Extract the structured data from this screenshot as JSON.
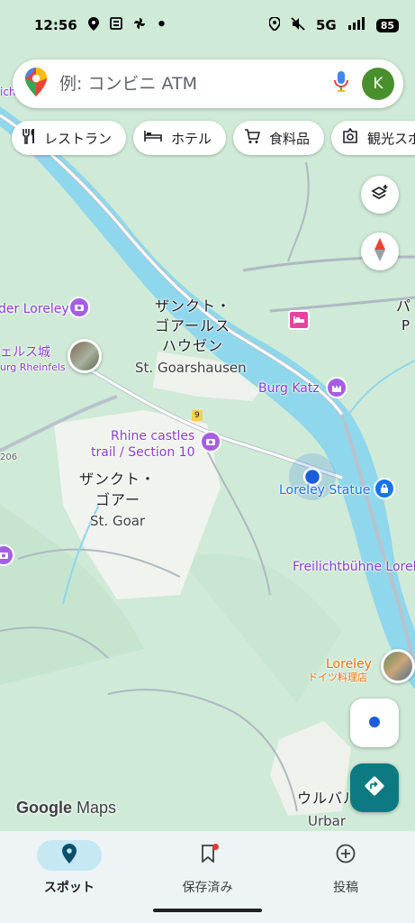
{
  "status_bar": {
    "time": "12:56",
    "network": "5G",
    "battery": "85"
  },
  "search": {
    "placeholder": "例: コンビニ ATM"
  },
  "account": {
    "initial": "K"
  },
  "chips": [
    {
      "label": "レストラン",
      "icon": "fork-knife-icon"
    },
    {
      "label": "ホテル",
      "icon": "bed-icon"
    },
    {
      "label": "食料品",
      "icon": "cart-icon"
    },
    {
      "label": "観光スポ",
      "icon": "camera-icon"
    }
  ],
  "map": {
    "labels": {
      "st_goarshausen_ja_1": "ザンクト・",
      "st_goarshausen_ja_2": "ゴアールス",
      "st_goarshausen_ja_3": "ハウゼン",
      "st_goarshausen_en": "St. Goarshausen",
      "st_goar_ja_1": "ザンクト・",
      "st_goar_ja_2": "ゴアー",
      "st_goar_en": "St. Goar",
      "burg_katz": "Burg Katz",
      "rhine_castles_1": "Rhine castles",
      "rhine_castles_2": "trail / Section 10",
      "loreley_statue": "Loreley Statue",
      "freilichtbuhne": "Freilichtbühne Lorel",
      "loreley_restaurant": "Loreley",
      "loreley_restaurant_sub": "ドイツ料理店",
      "der_loreley": "der Loreley",
      "rheinfels_ja": "ェルス城",
      "rheinfels_en": "urg Rheinfels",
      "urbar_ja": "ウルバル",
      "urbar_en": "Urbar",
      "road_9": "9",
      "road_206": "206",
      "pa_edge": "パ",
      "pa_edge2": "P",
      "ich_edge": "ich"
    }
  },
  "branding": {
    "google": "Google",
    "maps": "Maps"
  },
  "bottom_nav": [
    {
      "label": "スポット",
      "icon": "location-pin-icon",
      "active": true
    },
    {
      "label": "保存済み",
      "icon": "bookmark-icon",
      "active": false
    },
    {
      "label": "投稿",
      "icon": "add-circle-icon",
      "active": false
    }
  ],
  "colors": {
    "water": "#8fd7ec",
    "land": "#cfead7",
    "accent": "#1a73e8",
    "poi_purple": "#a55ee3",
    "directions": "#0d7a82"
  }
}
